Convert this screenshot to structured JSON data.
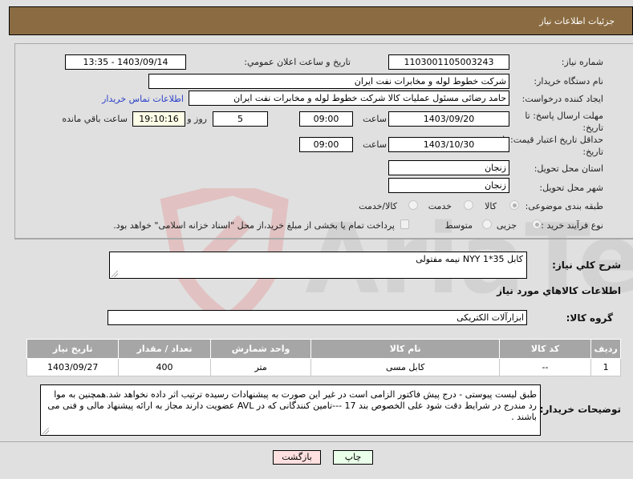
{
  "window": {
    "title": "جزئيات اطلاعات نياز"
  },
  "form": {
    "need_number": {
      "label": "شماره نیاز:",
      "value": "1103001105003243"
    },
    "announce_datetime": {
      "label": "تاريخ و ساعت اعلان عمومي:",
      "value": "1403/09/14 - 13:35"
    },
    "buyer_org": {
      "label": "نام دستگاه خریدار:",
      "value": "شرکت خطوط لوله و مخابرات نفت ایران"
    },
    "requester": {
      "label": "ایجاد کننده درخواست:",
      "value": "حامد  رضائی  مسئول عملیات کالا  شرکت خطوط لوله و مخابرات نفت ایران",
      "contact_link": "اطلاعات تماس خریدار"
    },
    "response_deadline": {
      "label": "مهلت ارسال پاسخ: تا تاریخ:",
      "date": "1403/09/20",
      "time_label": "ساعت",
      "time": "09:00",
      "days": "5",
      "days_label": "روز و",
      "remaining": "19:10:16",
      "remaining_label": "ساعت باقي مانده"
    },
    "price_validity": {
      "label": "حداقل تاریخ اعتبار قیمت: تا تاریخ:",
      "date": "1403/10/30",
      "time_label": "ساعت",
      "time": "09:00"
    },
    "delivery_province": {
      "label": "استان محل تحویل:",
      "value": "زنجان"
    },
    "delivery_city": {
      "label": "شهر محل تحویل:",
      "value": "زنجان"
    },
    "category": {
      "label": "طبقه بندی موضوعی:",
      "options": [
        "کالا",
        "خدمت",
        "کالا/خدمت"
      ],
      "selected": "کالا"
    },
    "purchase_type": {
      "label": "نوع فرآیند خرید :",
      "options": [
        "جزیی",
        "متوسط"
      ],
      "selected": "جزیی",
      "treasury_checkbox_label": "پرداخت تمام یا بخشی از مبلغ خرید،از محل \"اسناد خزانه اسلامی\" خواهد بود.",
      "treasury_checked": false
    }
  },
  "summary": {
    "label": "شرح کلي نياز:",
    "value": "کابل 35*1 NYY نیمه مفتولی"
  },
  "items_section": {
    "title": "اطلاعات کالاهاي مورد نياز",
    "group_label": "گروه کالا:",
    "group_value": "ابزارآلات الکتریکی",
    "columns": [
      "ردیف",
      "کد کالا",
      "نام کالا",
      "واحد شمارش",
      "تعداد / مقدار",
      "تاریخ نیاز"
    ],
    "rows": [
      [
        "1",
        "--",
        "کابل مسی",
        "متر",
        "400",
        "1403/09/27"
      ]
    ]
  },
  "buyer_notes": {
    "label": "توضیحات خریدار:",
    "value": "طبق لیست پیوستی - درج پیش فاکتور الزامی است در غیر این صورت به پیشنهادات رسیده ترتیب اثر داده نخواهد شد.همچنین به موا رد مندرج در شرایط دقت شود علی الخصوص بند 17 ---تامین کنندگانی که در AVL  عضویت دارند مجاز به ارائه پیشنهاد مالی و فنی می باشند ."
  },
  "buttons": {
    "print": "چاپ",
    "back": "بازگشت"
  },
  "watermark": {
    "text": "AriaTender.neT"
  },
  "colors": {
    "title_bar": "#8b6c42",
    "table_header": "#a6a6a6",
    "print_btn": "#eaffea",
    "back_btn": "#ffe0e0",
    "link": "#2a3fc8"
  }
}
